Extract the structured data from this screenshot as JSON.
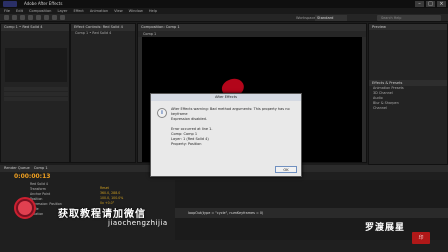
{
  "window": {
    "title": "Adobe After Effects"
  },
  "menu": [
    "File",
    "Edit",
    "Composition",
    "Layer",
    "Effect",
    "Animation",
    "View",
    "Window",
    "Help"
  ],
  "toolbar": {
    "workspace_label": "Workspace:",
    "workspace_value": "Standard",
    "search_placeholder": "Search Help"
  },
  "project_panel": {
    "tab": "Comp 1 • Red Solid 4"
  },
  "effect_controls": {
    "tab": "Effect Controls: Red Solid 4",
    "rows": [
      "Comp 1 • Red Solid 4"
    ]
  },
  "composition": {
    "tab": "Composition: Comp 1",
    "subtab": "Comp 1"
  },
  "right_panel": {
    "preview_header": "Preview",
    "effects_header": "Effects & Presets",
    "items": [
      "Animation Presets",
      "3D Channel",
      "Audio",
      "Blur & Sharpen",
      "Channel"
    ]
  },
  "timeline": {
    "tabs": [
      "Render Queue",
      "Comp 1"
    ],
    "timecode": "0:00:00:13",
    "layers": [
      "Red Solid 4",
      "Transform",
      "Anchor Point",
      "Position",
      "Expression: Position",
      "Scale",
      "Rotation"
    ],
    "values": [
      "",
      "Reset",
      "360.0, 288.0",
      "",
      "",
      "100.0, 100.0%",
      "0x +0.0°"
    ],
    "expression": "loopOut(type = \"cycle\", numKeyframes = 0)"
  },
  "dialog": {
    "title": "After Effects",
    "icon": "info-icon",
    "lines": [
      "After Effects warning: Bad method arguments: This property has no",
      "keyframe",
      "Expression disabled.",
      "",
      "Error occurred at line 1.",
      "Comp: Comp 1",
      "Layer: 1 (Red Solid 4)",
      "Property: Position"
    ],
    "ok_label": "OK"
  },
  "overlay": {
    "promo_text": "获取教程请加微信",
    "promo_id": "jiaochengzhijia",
    "brand_name": "罗渡展星",
    "seal_text": "印"
  },
  "colors": {
    "accent_timecode": "#f0a020",
    "solid_red": "#b3051a"
  }
}
